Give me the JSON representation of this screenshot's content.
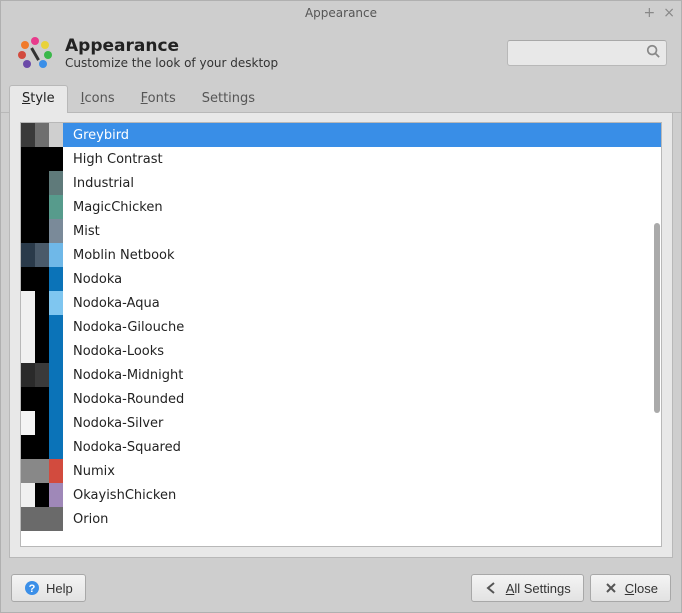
{
  "window": {
    "title": "Appearance"
  },
  "header": {
    "title": "Appearance",
    "subtitle": "Customize the look of your desktop",
    "search_placeholder": ""
  },
  "tabs": [
    {
      "label": "Style",
      "underlined_char": "S",
      "rest": "tyle",
      "active": true
    },
    {
      "label": "Icons",
      "underlined_char": "I",
      "rest": "cons",
      "active": false
    },
    {
      "label": "Fonts",
      "underlined_char": "F",
      "rest": "onts",
      "active": false
    },
    {
      "label": "Settings",
      "underlined_char": "",
      "rest": "Settings",
      "active": false
    }
  ],
  "themes": [
    {
      "name": "Greybird",
      "swatches": [
        "#3a3a3a",
        "#6f6f6f",
        "#cfcfcf"
      ],
      "selected": true
    },
    {
      "name": "High Contrast",
      "swatches": [
        "#000000",
        "#000000",
        "#000000"
      ],
      "selected": false
    },
    {
      "name": "Industrial",
      "swatches": [
        "#000000",
        "#000000",
        "#5f7a7a"
      ],
      "selected": false
    },
    {
      "name": "MagicChicken",
      "swatches": [
        "#000000",
        "#000000",
        "#579b8c"
      ],
      "selected": false
    },
    {
      "name": "Mist",
      "swatches": [
        "#000000",
        "#000000",
        "#7a8a99"
      ],
      "selected": false
    },
    {
      "name": "Moblin Netbook",
      "swatches": [
        "#2a3a4a",
        "#4a5a6a",
        "#6fb8e8"
      ],
      "selected": false
    },
    {
      "name": "Nodoka",
      "swatches": [
        "#000000",
        "#000000",
        "#0b73b8"
      ],
      "selected": false
    },
    {
      "name": "Nodoka-Aqua",
      "swatches": [
        "#f0f0f0",
        "#000000",
        "#7fc6f0"
      ],
      "selected": false
    },
    {
      "name": "Nodoka-Gilouche",
      "swatches": [
        "#f0f0f0",
        "#000000",
        "#0b73b8"
      ],
      "selected": false
    },
    {
      "name": "Nodoka-Looks",
      "swatches": [
        "#f0f0f0",
        "#000000",
        "#0b73b8"
      ],
      "selected": false
    },
    {
      "name": "Nodoka-Midnight",
      "swatches": [
        "#2a2a2a",
        "#3a3a3a",
        "#0b73b8"
      ],
      "selected": false
    },
    {
      "name": "Nodoka-Rounded",
      "swatches": [
        "#000000",
        "#000000",
        "#0b73b8"
      ],
      "selected": false
    },
    {
      "name": "Nodoka-Silver",
      "swatches": [
        "#f4f4f4",
        "#000000",
        "#0b73b8"
      ],
      "selected": false
    },
    {
      "name": "Nodoka-Squared",
      "swatches": [
        "#000000",
        "#000000",
        "#0b73b8"
      ],
      "selected": false
    },
    {
      "name": "Numix",
      "swatches": [
        "#888888",
        "#888888",
        "#d24b3e"
      ],
      "selected": false
    },
    {
      "name": "OkayishChicken",
      "swatches": [
        "#f0f0f0",
        "#000000",
        "#9f88b8"
      ],
      "selected": false
    },
    {
      "name": "Orion",
      "swatches": [
        "#6a6a6a",
        "#6a6a6a",
        "#6a6a6a"
      ],
      "selected": false
    }
  ],
  "footer": {
    "help": "Help",
    "all_settings": "All Settings",
    "close": "Close"
  }
}
